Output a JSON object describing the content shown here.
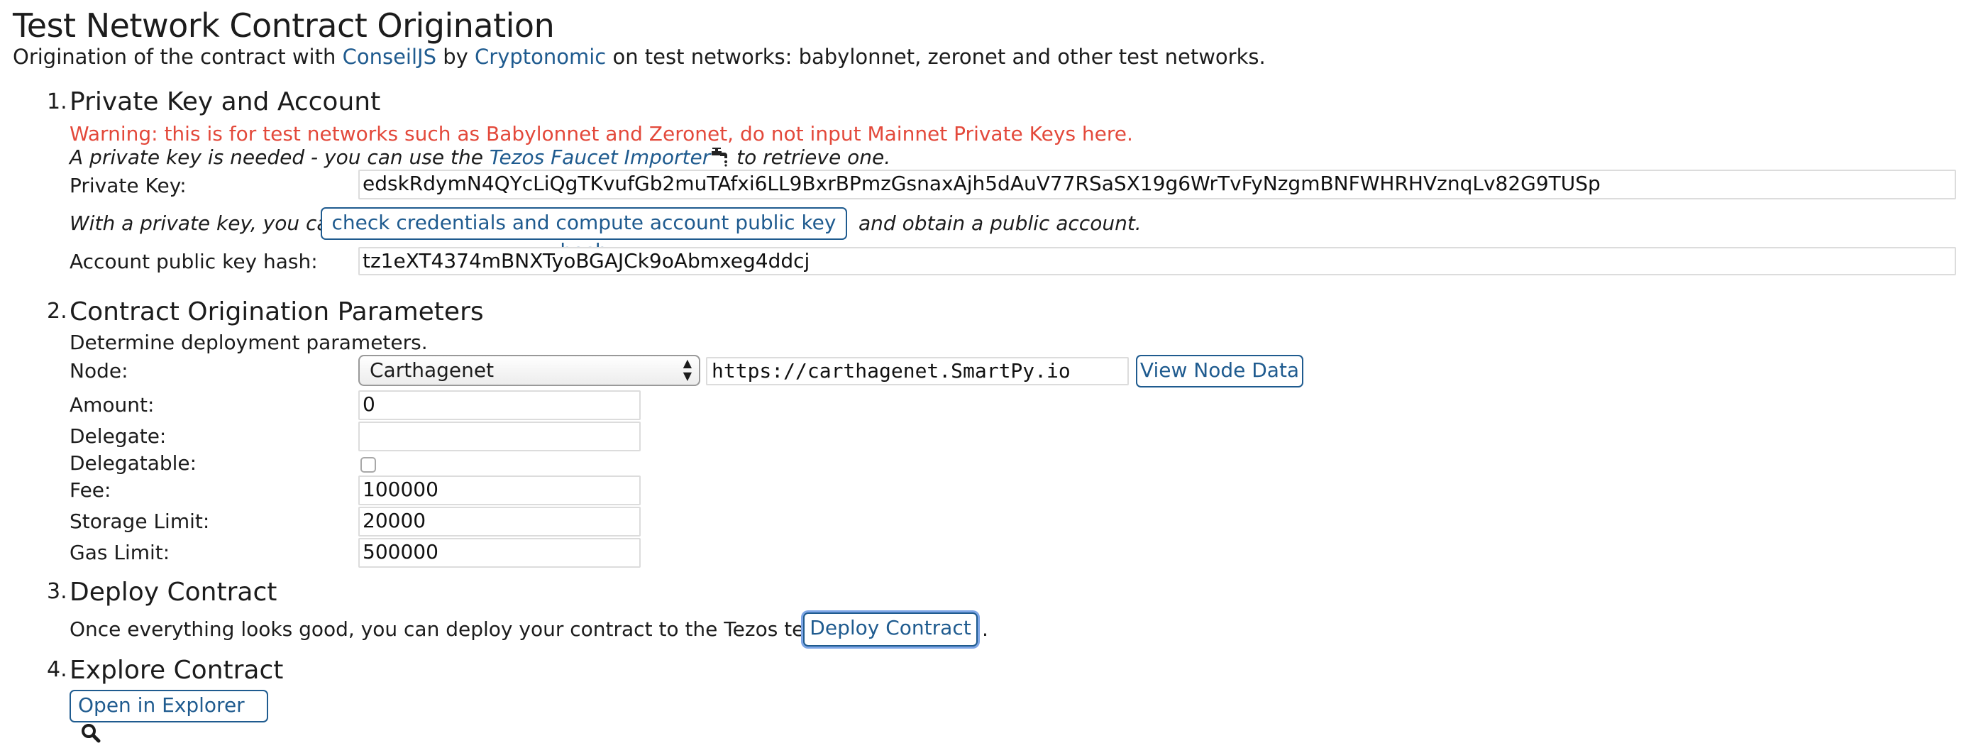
{
  "page": {
    "title": "Test Network Contract Origination",
    "intro": {
      "prefix": "Origination of the contract with ",
      "link1": "ConseilJS",
      "mid": " by ",
      "link2": "Cryptonomic",
      "suffix": " on test networks: babylonnet, zeronet and other test networks."
    }
  },
  "section1": {
    "number": "1.",
    "heading": "Private Key and Account",
    "warning": "Warning: this is for test networks such as Babylonnet and Zeronet, do not input Mainnet Private Keys here.",
    "note_prefix": "A private key is needed - you can use the ",
    "note_link": "Tezos Faucet Importer",
    "note_suffix": " to retrieve one.",
    "private_key_label": "Private Key:",
    "private_key_value": "edskRdymN4QYcLiQgTKvufGb2muTAfxi6LL9BxrBPmzGsnaxAjh5dAuV77RSaSX19g6WrTvFyNzgmBNFWHRHVznqLv82G9TUSp",
    "credentials_prefix": "With a private key, you can",
    "credentials_button": "check credentials and compute account public key hash",
    "credentials_suffix": "and obtain a public account.",
    "pkh_label": "Account public key hash:",
    "pkh_value": "tz1eXT4374mBNXTyoBGAJCk9oAbmxeg4ddcj"
  },
  "section2": {
    "number": "2.",
    "heading": "Contract Origination Parameters",
    "subtitle": "Determine deployment parameters.",
    "node_label": "Node:",
    "node_selected": "Carthagenet",
    "node_url": "https://carthagenet.SmartPy.io",
    "view_node_button": "View Node Data",
    "amount_label": "Amount:",
    "amount_value": "0",
    "delegate_label": "Delegate:",
    "delegate_value": "",
    "delegatable_label": "Delegatable:",
    "delegatable_checked": false,
    "fee_label": "Fee:",
    "fee_value": "100000",
    "storage_label": "Storage Limit:",
    "storage_value": "20000",
    "gas_label": "Gas Limit:",
    "gas_value": "500000"
  },
  "section3": {
    "number": "3.",
    "heading": "Deploy Contract",
    "text": "Once everything looks good, you can deploy your contract to the Tezos test net:",
    "button": "Deploy Contract",
    "period": "."
  },
  "section4": {
    "number": "4.",
    "heading": "Explore Contract",
    "button": "Open in Explorer"
  },
  "colors": {
    "link": "#1f5b8f",
    "warning": "#e3493b",
    "focus_ring": "#7ea6e6"
  },
  "icons": [
    "faucet-icon",
    "search-icon"
  ]
}
